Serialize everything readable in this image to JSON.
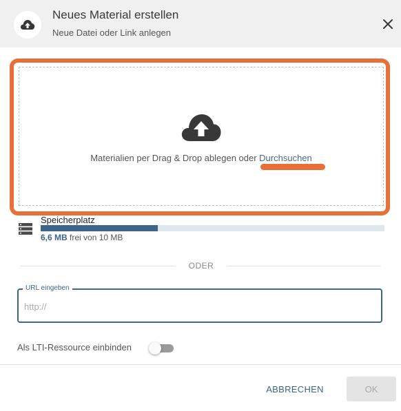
{
  "header": {
    "icon": "cloud-upload-icon",
    "title": "Neues Material erstellen",
    "subtitle": "Neue Datei oder Link anlegen",
    "close_icon": "close-icon"
  },
  "dropzone": {
    "icon": "cloud-upload-icon",
    "text": "Materialien per Drag & Drop ablegen oder ",
    "browse_link": "Durchsuchen"
  },
  "storage": {
    "icon": "storage-icon",
    "title": "Speicherplatz",
    "used_value": "6,6 MB",
    "used_suffix": " frei von 10 MB",
    "fill_fraction": 0.34
  },
  "divider": {
    "label": "ODER"
  },
  "url_field": {
    "label": "URL eingeben",
    "placeholder": "http://",
    "value": ""
  },
  "lti": {
    "label": "Als LTI-Ressource einbinden",
    "enabled": false
  },
  "footer": {
    "cancel_label": "ABBRECHEN",
    "ok_label": "OK"
  },
  "colors": {
    "accent": "#3d6587",
    "highlight": "#e87038",
    "header_bg": "#f0f0f0"
  }
}
